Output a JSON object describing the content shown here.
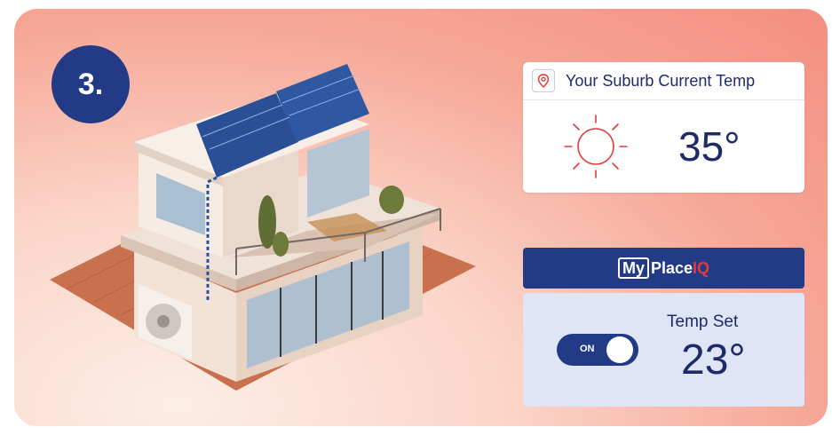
{
  "step": {
    "label": "3."
  },
  "weather": {
    "title": "Your Suburb Current Temp",
    "temperature": "35°",
    "icon": "sun-icon"
  },
  "brand": {
    "my": "My",
    "place": "Place",
    "iq": "IQ"
  },
  "control": {
    "toggle_label": "ON",
    "toggle_on": true,
    "temp_set_label": "Temp Set",
    "temp_set_value": "23°"
  },
  "colors": {
    "navy": "#233a86",
    "text_navy": "#1f2a6b",
    "sun_red": "#e23b3b",
    "panel_blue": "#dfe5f5"
  }
}
